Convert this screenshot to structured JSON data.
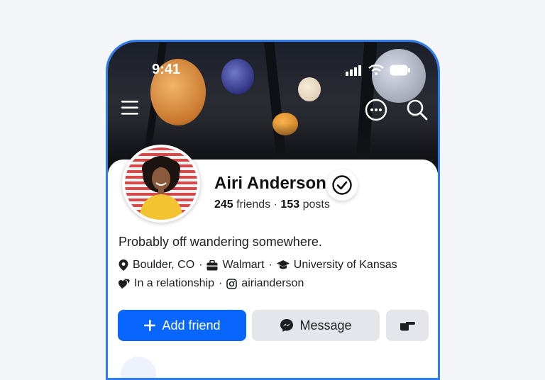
{
  "status_bar": {
    "time": "9:41"
  },
  "profile": {
    "name": "Airi Anderson",
    "friends_count": "245",
    "friends_label": "friends",
    "separator": "·",
    "posts_count": "153",
    "posts_label": "posts",
    "bio": "Probably off wandering somewhere.",
    "location": "Boulder, CO",
    "work": "Walmart",
    "education": "University of Kansas",
    "relationship": "In a relationship",
    "instagram": "airianderson"
  },
  "actions": {
    "add_friend_label": "Add friend",
    "message_label": "Message"
  },
  "colors": {
    "accent": "#0866ff",
    "secondary_button": "#e4e6eb",
    "phone_border": "#2d7cf0"
  }
}
